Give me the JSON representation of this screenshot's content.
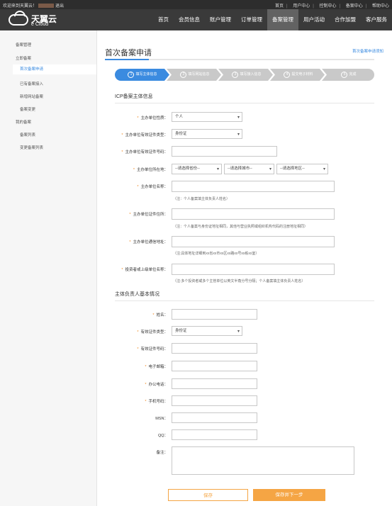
{
  "topbar": {
    "welcome_prefix": "欢迎来到天翼云！",
    "logout": "退出",
    "links": [
      "首页",
      "用户中心",
      "控制中心",
      "备案中心",
      "帮助中心"
    ]
  },
  "header": {
    "brand": "天翼云",
    "brand_sub": "e Cloud",
    "nav": [
      "首页",
      "会员信息",
      "账户管理",
      "订单管理",
      "备案管理",
      "用户活动",
      "合作加盟",
      "客户服务"
    ]
  },
  "sidebar": {
    "group1": "备案管理",
    "immediate": "立即备案",
    "items": [
      "首次备案申请",
      "已有备案接入",
      "新增网站备案",
      "备案变更"
    ],
    "my_group": "我的备案",
    "my_items": [
      "备案列表",
      "变更备案列表"
    ]
  },
  "page": {
    "title": "首次备案申请",
    "notice_link": "首次备案申请须知"
  },
  "steps": [
    {
      "num": "1",
      "label": "填写主体信息"
    },
    {
      "num": "2",
      "label": "填写网站信息"
    },
    {
      "num": "3",
      "label": "填写接入信息"
    },
    {
      "num": "4",
      "label": "提交电子材料"
    },
    {
      "num": "5",
      "label": "完成"
    }
  ],
  "section1": {
    "title": "ICP备案主体信息",
    "unit_nature_label": "主办单位性质：",
    "unit_nature_value": "个人",
    "cert_type_label": "主办单位有效证件类型：",
    "cert_type_value": "身份证",
    "cert_no_label": "主办单位有效证件号码：",
    "location_label": "主办单位所在地：",
    "province": "--请选择省份--",
    "city": "--请选择城市--",
    "district": "--请选择地区--",
    "unit_name_label": "主办单位名称：",
    "unit_name_hint": "（注：个人备案填主体负责人姓名）",
    "cert_address_label": "主办单位证件住所：",
    "cert_address_hint": "（注：个人备案与身份证地址相同，其他与营业执照或组织机构代码的注册地址相同）",
    "mail_address_label": "主办单位通信地址：",
    "mail_address_hint": "（注:具体地址详细到xx省xx市xx区xx路xx号xx栋xx室）",
    "investor_label": "投资者或上级单位名称：",
    "investor_hint": "（注:多个投资者或多个主管单位以英文半角分号分隔；个人备案填主体负责人姓名）"
  },
  "section2": {
    "title": "主体负责人基本情况",
    "name_label": "姓名：",
    "cert_type_label": "有效证件类型：",
    "cert_type_value": "身份证",
    "cert_no_label": "有效证件号码：",
    "email_label": "电子邮箱：",
    "office_phone_label": "办公电话：",
    "mobile_label": "手机号码：",
    "msn_label": "MSN：",
    "qq_label": "QQ：",
    "remark_label": "备注："
  },
  "buttons": {
    "save": "保存",
    "save_next": "保存并下一步"
  },
  "colors": {
    "accent": "#3b8be0",
    "orange": "#f5a544",
    "step_active": "#3b8be0",
    "step_inactive": "#c9c9c9"
  }
}
